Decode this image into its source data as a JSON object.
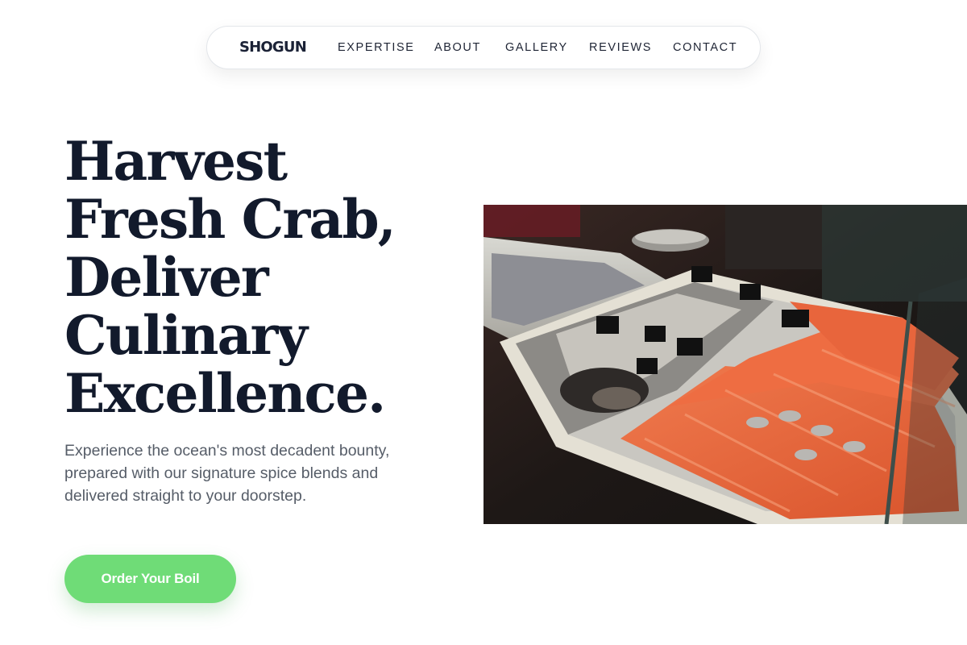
{
  "nav": {
    "brand": "SHOGUN",
    "links": [
      "EXPERTISE",
      "ABOUT",
      "GALLERY",
      "REVIEWS",
      "CONTACT"
    ]
  },
  "hero": {
    "title_lines": [
      "Harvest",
      "Fresh Crab,",
      "Deliver",
      "Culinary",
      "Excellence."
    ],
    "subtitle": "Experience the ocean's most decadent bounty, prepared with our signature spice blends and delivered straight to your doorstep.",
    "cta_label": "Order Your Boil",
    "image_subject": "seafood-market-display-photo"
  },
  "colors": {
    "accent": "#6fdc77",
    "heading": "#121a2c",
    "body_text": "#565d68"
  }
}
